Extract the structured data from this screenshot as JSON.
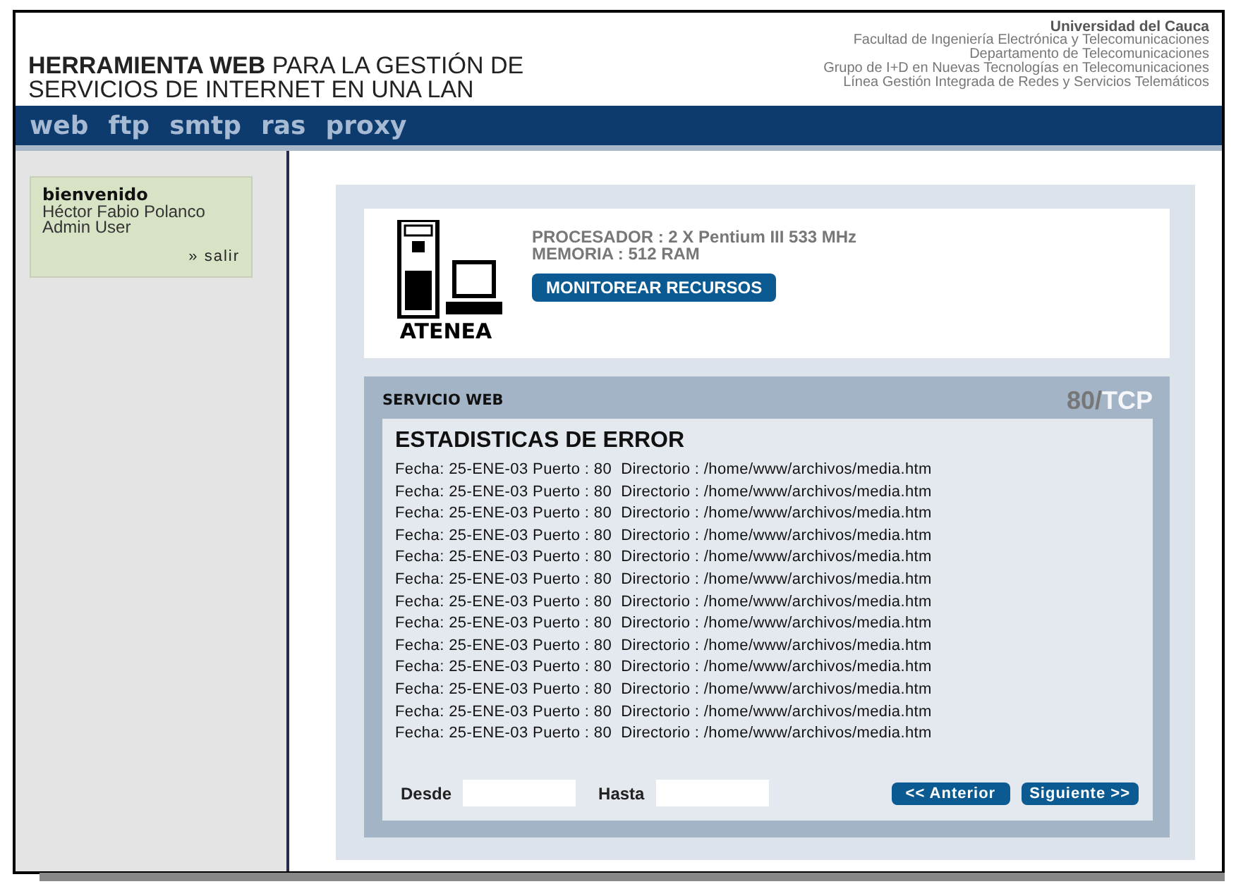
{
  "header": {
    "title_bold": "HERRAMIENTA WEB",
    "title_rest": " PARA LA GESTIÓN DE",
    "title_line2": "SERVICIOS DE INTERNET EN UNA LAN",
    "institution": [
      "Universidad del Cauca",
      "Facultad de Ingeniería Electrónica y Telecomunicaciones",
      "Departamento de Telecomunicaciones",
      "Grupo de I+D en Nuevas Tecnologías en Telecomunicaciones",
      "Línea Gestión Integrada de Redes y Servicios Telemáticos"
    ]
  },
  "nav": [
    "web",
    "ftp",
    "smtp",
    "ras",
    "proxy"
  ],
  "user_box": {
    "greeting": "bienvenido",
    "name": "Héctor Fabio Polanco",
    "role": "Admin User",
    "logout": "» salir"
  },
  "server": {
    "name": "ATENEA",
    "processor": "PROCESADOR : 2 X Pentium III 533 MHz",
    "memory": "MEMORIA : 512 RAM",
    "button": "MONITOREAR RECURSOS"
  },
  "service": {
    "title": "SERVICIO WEB",
    "port": "80/",
    "protocol": "TCP"
  },
  "errors": {
    "title": "ESTADISTICAS DE ERROR",
    "rows": [
      "Fecha: 25-ENE-03 Puerto : 80  Directorio : /home/www/archivos/media.htm",
      "Fecha: 25-ENE-03 Puerto : 80  Directorio : /home/www/archivos/media.htm",
      "Fecha: 25-ENE-03 Puerto : 80  Directorio : /home/www/archivos/media.htm",
      "Fecha: 25-ENE-03 Puerto : 80  Directorio : /home/www/archivos/media.htm",
      "Fecha: 25-ENE-03 Puerto : 80  Directorio : /home/www/archivos/media.htm",
      "Fecha: 25-ENE-03 Puerto : 80  Directorio : /home/www/archivos/media.htm",
      "Fecha: 25-ENE-03 Puerto : 80  Directorio : /home/www/archivos/media.htm",
      "Fecha: 25-ENE-03 Puerto : 80  Directorio : /home/www/archivos/media.htm",
      "Fecha: 25-ENE-03 Puerto : 80  Directorio : /home/www/archivos/media.htm",
      "Fecha: 25-ENE-03 Puerto : 80  Directorio : /home/www/archivos/media.htm",
      "Fecha: 25-ENE-03 Puerto : 80  Directorio : /home/www/archivos/media.htm",
      "Fecha: 25-ENE-03 Puerto : 80  Directorio : /home/www/archivos/media.htm",
      "Fecha: 25-ENE-03 Puerto : 80  Directorio : /home/www/archivos/media.htm"
    ],
    "from_label": "Desde",
    "to_label": "Hasta",
    "prev": "<< Anterior",
    "next": "Siguiente >>"
  }
}
